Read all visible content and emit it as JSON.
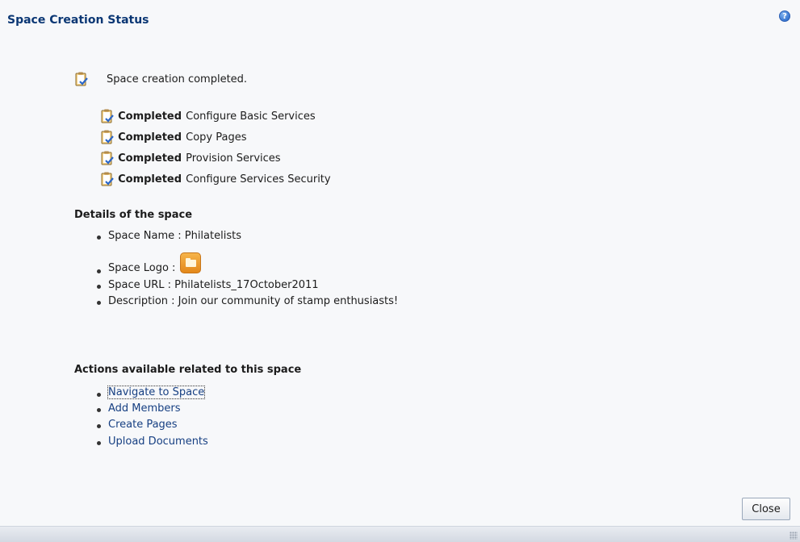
{
  "dialog": {
    "title": "Space Creation Status",
    "help_icon_glyph": "?",
    "close_label": "Close"
  },
  "status": {
    "message": "Space creation completed.",
    "steps": [
      {
        "status": "Completed",
        "task": "Configure Basic Services"
      },
      {
        "status": "Completed",
        "task": "Copy Pages"
      },
      {
        "status": "Completed",
        "task": "Provision Services"
      },
      {
        "status": "Completed",
        "task": "Configure Services Security"
      }
    ]
  },
  "details": {
    "heading": "Details of the space",
    "name_label": "Space Name : Philatelists",
    "logo_label": "Space Logo :",
    "url_label": "Space URL : Philatelists_17October2011",
    "description_label": "Description : Join our community of stamp enthusiasts!"
  },
  "actions": {
    "heading": "Actions available related to this space",
    "items": [
      "Navigate to Space",
      "Add Members",
      "Create Pages",
      "Upload Documents"
    ]
  },
  "colors": {
    "title": "#0b3774",
    "link": "#163f82",
    "background": "#f7f8fa"
  }
}
